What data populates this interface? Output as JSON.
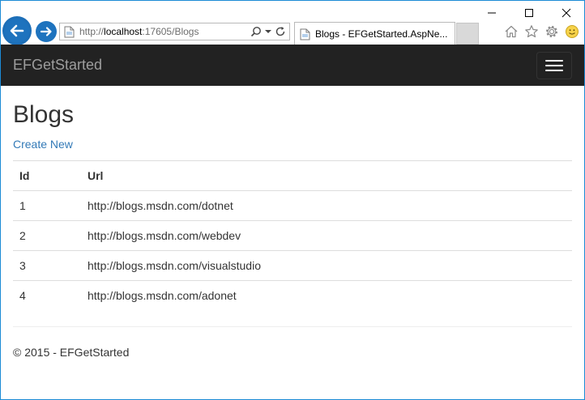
{
  "browser": {
    "address_url_host": "http://",
    "address_url_domain": "localhost",
    "address_url_rest": ":17605/Blogs",
    "tab_title": "Blogs - EFGetStarted.AspNe...",
    "icons": [
      "back-arrow-icon",
      "forward-arrow-icon",
      "page-icon",
      "search-icon",
      "dropdown-icon",
      "refresh-icon",
      "home-icon",
      "favorites-star-icon",
      "settings-gear-icon",
      "smiley-feedback-icon",
      "minimize-icon",
      "maximize-icon",
      "close-icon"
    ]
  },
  "navbar": {
    "brand": "EFGetStarted"
  },
  "page": {
    "title": "Blogs",
    "create_link": "Create New"
  },
  "table": {
    "headers": [
      "Id",
      "Url"
    ],
    "rows": [
      {
        "id": "1",
        "url": "http://blogs.msdn.com/dotnet"
      },
      {
        "id": "2",
        "url": "http://blogs.msdn.com/webdev"
      },
      {
        "id": "3",
        "url": "http://blogs.msdn.com/visualstudio"
      },
      {
        "id": "4",
        "url": "http://blogs.msdn.com/adonet"
      }
    ]
  },
  "footer": {
    "text": "© 2015 - EFGetStarted"
  },
  "colors": {
    "navbar_bg": "#222222",
    "brand_text": "#9d9d9d",
    "link": "#337ab7",
    "window_border": "#1c8bd6",
    "nav_button": "#1e73be"
  }
}
